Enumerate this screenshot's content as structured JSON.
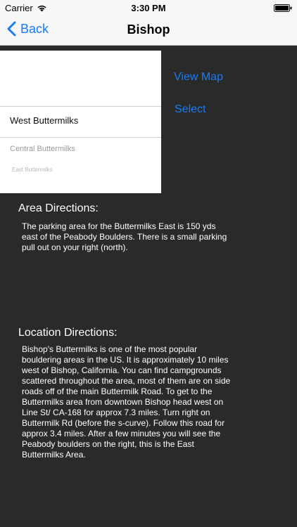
{
  "status_bar": {
    "carrier": "Carrier",
    "time": "3:30 PM",
    "wifi_icon": "wifi-icon",
    "battery_icon": "battery-icon"
  },
  "nav": {
    "back_label": "Back",
    "title": "Bishop",
    "back_icon": "chevron-left-icon",
    "accent_color": "#1a7cf5"
  },
  "picker": {
    "options": [
      "West Buttermilks",
      "Central Buttermilks",
      "East Buttermilks"
    ],
    "selected": "West Buttermilks"
  },
  "actions": {
    "view_map": "View Map",
    "select": "Select"
  },
  "area": {
    "heading": "Area Directions:",
    "text": "The parking area for the Buttermilks East is 150 yds east of the Peabody Boulders. There is a small parking pull out on your right (north)."
  },
  "location": {
    "heading": "Location Directions:",
    "text": "Bishop's Buttermilks is one of the most popular bouldering areas in the US. It is approximately 10 miles west of Bishop, California. You can find campgrounds scattered throughout the area, most of them are on side roads off of the main Buttermilk Road. To get to the Buttermilks area from downtown Bishop head west on Line St/ CA-168 for approx 7.3 miles. Turn right on Buttermilk Rd (before the s-curve). Follow this road for approx 3.4 miles. After a few minutes you will see the Peabody boulders on the right, this is the East Buttermilks Area."
  }
}
